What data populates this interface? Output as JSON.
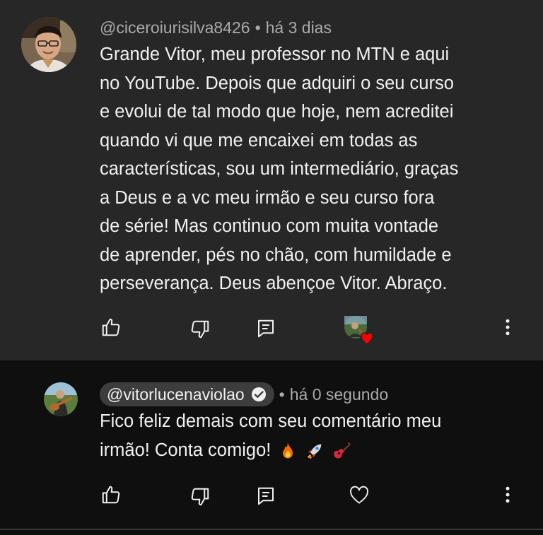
{
  "comment": {
    "author": "@ciceroiurisilva8426",
    "separator": "•",
    "time": "há 3 dias",
    "lines": [
      "Grande Vitor, meu professor no MTN e aqui",
      "no YouTube. Depois que adquiri o seu curso",
      "e evolui de tal modo que hoje, nem acreditei",
      "quando vi que me encaixei em todas as",
      "características, sou um intermediário, graças",
      "a Deus e a vc meu irmão e seu curso fora",
      "de série! Mas continuo com muita vontade",
      "de aprender, pés no chão, com humildade e",
      "perseverança. Deus abençoe Vitor. Abraço."
    ],
    "actions": {
      "like": "thumb-up-icon",
      "dislike": "thumb-down-icon",
      "reply": "reply-icon",
      "creator_heart": "creator-heart-badge",
      "more": "more-vert-icon"
    }
  },
  "reply": {
    "author": "@vitorlucenaviolao",
    "verified": true,
    "separator": "•",
    "time": "há 0 segundo",
    "lines": [
      "Fico feliz demais com seu comentário meu",
      "irmão! Conta comigo!"
    ],
    "emojis": [
      "fire-emoji",
      "rocket-emoji",
      "guitar-emoji"
    ],
    "actions": {
      "like": "thumb-up-icon",
      "dislike": "thumb-down-icon",
      "reply": "reply-icon",
      "heart": "heart-outline-icon",
      "more": "more-vert-icon"
    }
  },
  "colors": {
    "comment_bg": "#272727",
    "reply_bg": "#0f0f0f",
    "text": "#f1f1f1",
    "meta": "#aaaaaa",
    "heart": "#ff0000"
  }
}
